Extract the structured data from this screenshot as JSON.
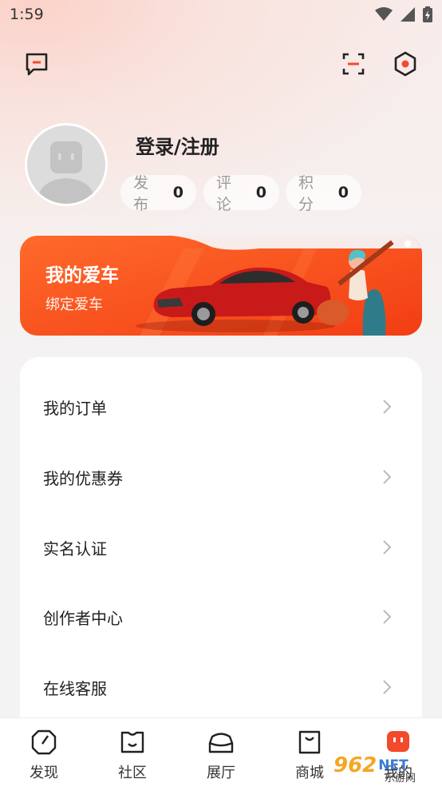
{
  "status_bar": {
    "time": "1:59"
  },
  "profile": {
    "login_label": "登录/注册"
  },
  "stats": [
    {
      "label": "发布",
      "value": "0"
    },
    {
      "label": "评论",
      "value": "0"
    },
    {
      "label": "积分",
      "value": "0"
    }
  ],
  "car_banner": {
    "title": "我的爱车",
    "subtitle": "绑定爱车"
  },
  "menu": [
    {
      "label": "我的订单"
    },
    {
      "label": "我的优惠券"
    },
    {
      "label": "实名认证"
    },
    {
      "label": "创作者中心"
    },
    {
      "label": "在线客服"
    }
  ],
  "bottom_nav": [
    {
      "label": "发现",
      "icon": "discover-icon"
    },
    {
      "label": "社区",
      "icon": "community-icon"
    },
    {
      "label": "展厅",
      "icon": "showroom-icon"
    },
    {
      "label": "商城",
      "icon": "mall-icon"
    },
    {
      "label": "我的",
      "icon": "profile-icon"
    }
  ],
  "watermark": {
    "number": "962",
    "suffix": "NET",
    "sub": "乐游网"
  },
  "colors": {
    "accent": "#f24a2a",
    "banner_orange": "#ff5a20"
  }
}
